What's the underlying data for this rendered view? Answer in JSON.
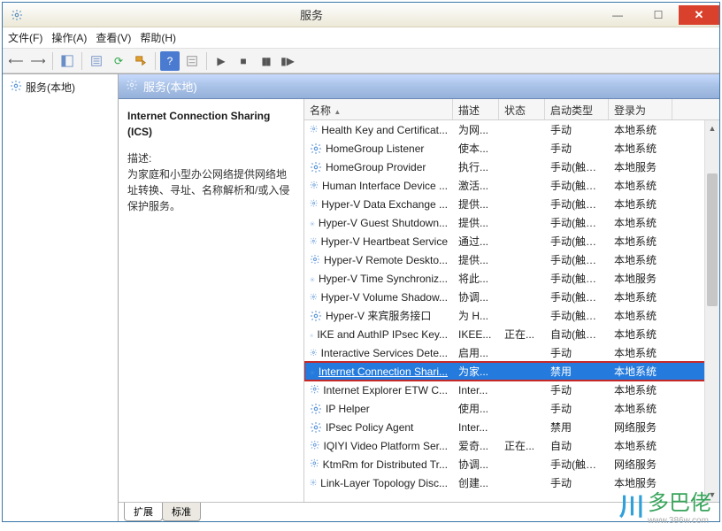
{
  "titlebar": {
    "title": "服务"
  },
  "menu": {
    "file": "文件(F)",
    "action": "操作(A)",
    "view": "查看(V)",
    "help": "帮助(H)"
  },
  "tree": {
    "root": "服务(本地)"
  },
  "pane_header": "服务(本地)",
  "desc": {
    "title": "Internet Connection Sharing (ICS)",
    "label": "描述:",
    "text": "为家庭和小型办公网络提供网络地址转换、寻址、名称解析和/或入侵保护服务。"
  },
  "columns": {
    "name": "名称",
    "desc": "描述",
    "state": "状态",
    "start": "启动类型",
    "logon": "登录为"
  },
  "tabs": {
    "extended": "扩展",
    "standard": "标准"
  },
  "services": [
    {
      "name": "Health Key and Certificat...",
      "desc": "为网...",
      "state": "",
      "start": "手动",
      "logon": "本地系统"
    },
    {
      "name": "HomeGroup Listener",
      "desc": "使本...",
      "state": "",
      "start": "手动",
      "logon": "本地系统"
    },
    {
      "name": "HomeGroup Provider",
      "desc": "执行...",
      "state": "",
      "start": "手动(触发...",
      "logon": "本地服务"
    },
    {
      "name": "Human Interface Device ...",
      "desc": "激活...",
      "state": "",
      "start": "手动(触发...",
      "logon": "本地系统"
    },
    {
      "name": "Hyper-V Data Exchange ...",
      "desc": "提供...",
      "state": "",
      "start": "手动(触发...",
      "logon": "本地系统"
    },
    {
      "name": "Hyper-V Guest Shutdown...",
      "desc": "提供...",
      "state": "",
      "start": "手动(触发...",
      "logon": "本地系统"
    },
    {
      "name": "Hyper-V Heartbeat Service",
      "desc": "通过...",
      "state": "",
      "start": "手动(触发...",
      "logon": "本地系统"
    },
    {
      "name": "Hyper-V Remote Deskto...",
      "desc": "提供...",
      "state": "",
      "start": "手动(触发...",
      "logon": "本地系统"
    },
    {
      "name": "Hyper-V Time Synchroniz...",
      "desc": "将此...",
      "state": "",
      "start": "手动(触发...",
      "logon": "本地服务"
    },
    {
      "name": "Hyper-V Volume Shadow...",
      "desc": "协调...",
      "state": "",
      "start": "手动(触发...",
      "logon": "本地系统"
    },
    {
      "name": "Hyper-V 来宾服务接口",
      "desc": "为 H...",
      "state": "",
      "start": "手动(触发...",
      "logon": "本地系统"
    },
    {
      "name": "IKE and AuthIP IPsec Key...",
      "desc": "IKEE...",
      "state": "正在...",
      "start": "自动(触发...",
      "logon": "本地系统"
    },
    {
      "name": "Interactive Services Dete...",
      "desc": "启用...",
      "state": "",
      "start": "手动",
      "logon": "本地系统"
    },
    {
      "name": "Internet Connection Shari...",
      "desc": "为家...",
      "state": "",
      "start": "禁用",
      "logon": "本地系统",
      "selected": true
    },
    {
      "name": "Internet Explorer ETW C...",
      "desc": "Inter...",
      "state": "",
      "start": "手动",
      "logon": "本地系统"
    },
    {
      "name": "IP Helper",
      "desc": "使用...",
      "state": "",
      "start": "手动",
      "logon": "本地系统"
    },
    {
      "name": "IPsec Policy Agent",
      "desc": "Inter...",
      "state": "",
      "start": "禁用",
      "logon": "网络服务"
    },
    {
      "name": "IQIYI Video Platform Ser...",
      "desc": "爱奇...",
      "state": "正在...",
      "start": "自动",
      "logon": "本地系统"
    },
    {
      "name": "KtmRm for Distributed Tr...",
      "desc": "协调...",
      "state": "",
      "start": "手动(触发...",
      "logon": "网络服务"
    },
    {
      "name": "Link-Layer Topology Disc...",
      "desc": "创建...",
      "state": "",
      "start": "手动",
      "logon": "本地服务"
    }
  ],
  "watermark": {
    "brand": "多巴佬",
    "url": "www.386w.com"
  }
}
